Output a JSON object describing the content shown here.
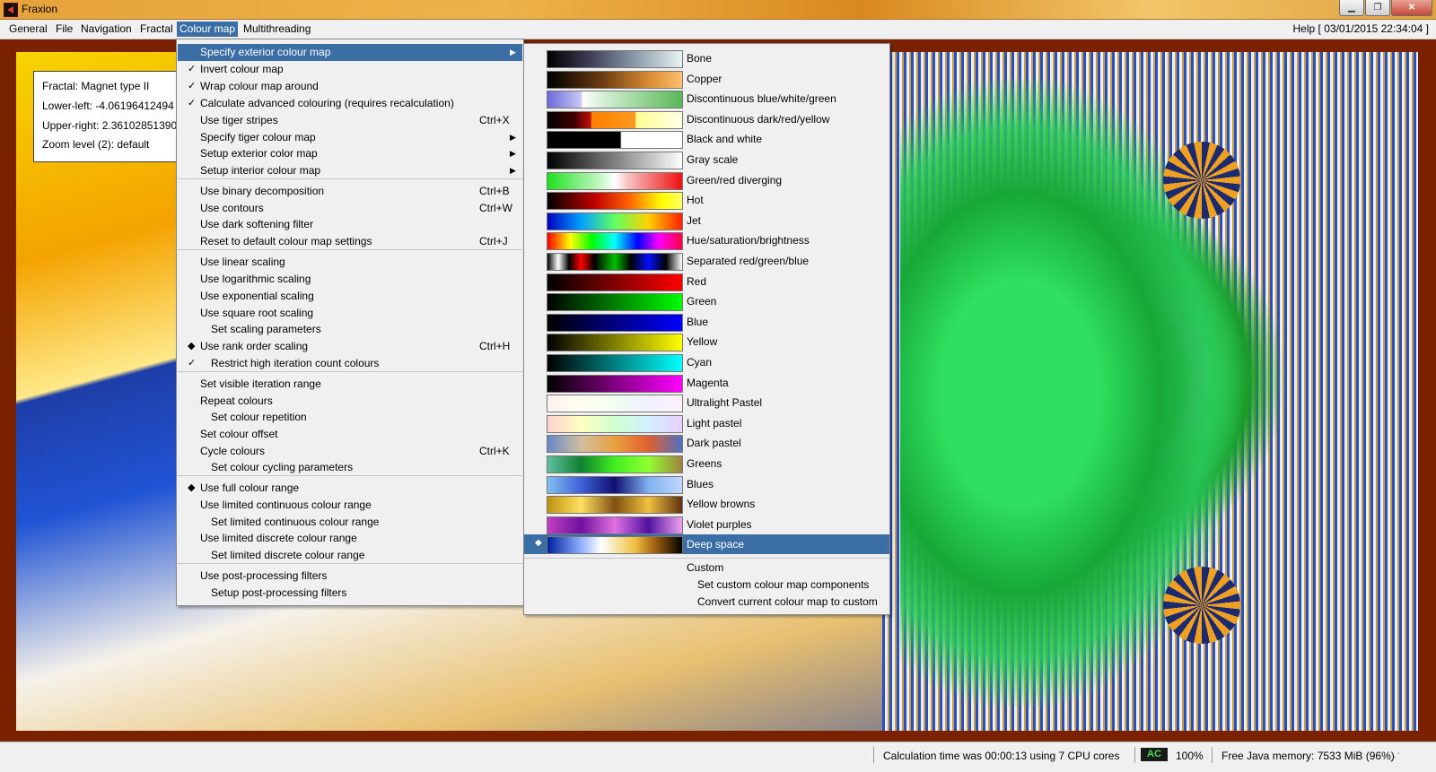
{
  "window": {
    "title": "Fraxion"
  },
  "menubar": {
    "items": [
      "General",
      "File",
      "Navigation",
      "Fractal",
      "Colour map",
      "Multithreading"
    ],
    "help": "Help",
    "datetime": "[ 03/01/2015 22:34:04 ]"
  },
  "info": {
    "fractal": "Fractal: Magnet type II",
    "lower_left": "Lower-left: -4.06196412494",
    "upper_right": "Upper-right: 2.36102851390",
    "zoom": "Zoom level (2): default"
  },
  "colour_menu": {
    "items": [
      {
        "label": "Specify exterior colour map",
        "mark": "",
        "shortcut": "",
        "submenu": true,
        "selected": true
      },
      {
        "label": "Invert colour map",
        "mark": "✓",
        "shortcut": "",
        "submenu": false
      },
      {
        "label": "Wrap colour map around",
        "mark": "✓",
        "shortcut": "",
        "submenu": false
      },
      {
        "label": "Calculate advanced colouring (requires recalculation)",
        "mark": "✓",
        "shortcut": "",
        "submenu": false
      },
      {
        "label": "Use tiger stripes",
        "mark": "",
        "shortcut": "Ctrl+X",
        "submenu": false
      },
      {
        "label": "Specify tiger colour map",
        "mark": "",
        "shortcut": "",
        "submenu": true
      },
      {
        "label": "Setup exterior color map",
        "mark": "",
        "shortcut": "",
        "submenu": true
      },
      {
        "label": "Setup interior colour map",
        "mark": "",
        "shortcut": "",
        "submenu": true
      },
      {
        "label": "Use binary decomposition",
        "mark": "",
        "shortcut": "Ctrl+B",
        "submenu": false
      },
      {
        "label": "Use contours",
        "mark": "",
        "shortcut": "Ctrl+W",
        "submenu": false
      },
      {
        "label": "Use dark softening filter",
        "mark": "",
        "shortcut": "",
        "submenu": false
      },
      {
        "label": "Reset to default colour map settings",
        "mark": "",
        "shortcut": "Ctrl+J",
        "submenu": false
      },
      {
        "label": "Use linear scaling",
        "mark": "",
        "shortcut": "",
        "submenu": false
      },
      {
        "label": "Use logarithmic scaling",
        "mark": "",
        "shortcut": "",
        "submenu": false
      },
      {
        "label": "Use exponential scaling",
        "mark": "",
        "shortcut": "",
        "submenu": false
      },
      {
        "label": "Use square root scaling",
        "mark": "",
        "shortcut": "",
        "submenu": false
      },
      {
        "label": "Set scaling parameters",
        "mark": "",
        "shortcut": "",
        "submenu": false,
        "indent": true
      },
      {
        "label": "Use rank order scaling",
        "mark": "◆",
        "shortcut": "Ctrl+H",
        "submenu": false
      },
      {
        "label": "Restrict high iteration count colours",
        "mark": "✓",
        "shortcut": "",
        "submenu": false,
        "indent": true
      },
      {
        "label": "Set visible iteration range",
        "mark": "",
        "shortcut": "",
        "submenu": false
      },
      {
        "label": "Repeat colours",
        "mark": "",
        "shortcut": "",
        "submenu": false
      },
      {
        "label": "Set colour repetition",
        "mark": "",
        "shortcut": "",
        "submenu": false,
        "indent": true
      },
      {
        "label": "Set colour offset",
        "mark": "",
        "shortcut": "",
        "submenu": false
      },
      {
        "label": "Cycle colours",
        "mark": "",
        "shortcut": "Ctrl+K",
        "submenu": false
      },
      {
        "label": "Set colour cycling parameters",
        "mark": "",
        "shortcut": "",
        "submenu": false,
        "indent": true
      },
      {
        "label": "Use full colour range",
        "mark": "◆",
        "shortcut": "",
        "submenu": false
      },
      {
        "label": "Use limited continuous colour range",
        "mark": "",
        "shortcut": "",
        "submenu": false
      },
      {
        "label": "Set limited continuous colour range",
        "mark": "",
        "shortcut": "",
        "submenu": false,
        "indent": true
      },
      {
        "label": "Use limited discrete colour range",
        "mark": "",
        "shortcut": "",
        "submenu": false
      },
      {
        "label": "Set limited discrete colour range",
        "mark": "",
        "shortcut": "",
        "submenu": false,
        "indent": true
      },
      {
        "label": "Use post-processing filters",
        "mark": "",
        "shortcut": "",
        "submenu": false
      },
      {
        "label": "Setup post-processing filters",
        "mark": "",
        "shortcut": "",
        "submenu": false,
        "indent": true
      }
    ]
  },
  "colour_maps": {
    "items": [
      {
        "name": "Bone",
        "gradient": "linear-gradient(90deg,#000 0%,#3a3a52 30%,#8a9aa8 65%,#e8f4f4 100%)"
      },
      {
        "name": "Copper",
        "gradient": "linear-gradient(90deg,#000 0%,#6a3a12 40%,#d88a30 75%,#ffc070 100%)"
      },
      {
        "name": "Discontinuous blue/white/green",
        "gradient": "linear-gradient(90deg,#6a6ad8 0%,#c8c8f8 25%,#fff 26%,#d8f0d8 40%,#58b858 100%)"
      },
      {
        "name": "Discontinuous dark/red/yellow",
        "gradient": "linear-gradient(90deg,#000 0%,#400000 20%,#c01000 32%,#ff8000 33%,#ff9820 65%,#ffff90 66%,#ffffe8 100%)"
      },
      {
        "name": "Black and white",
        "gradient": "linear-gradient(90deg,#000 0%,#000 54%,#fff 55%,#fff 100%)"
      },
      {
        "name": "Gray scale",
        "gradient": "linear-gradient(90deg,#000 0%,#fff 100%)"
      },
      {
        "name": "Green/red diverging",
        "gradient": "linear-gradient(90deg,#20e020 0%,#c8f8c8 40%,#fff 50%,#f8c0c0 60%,#f01010 100%)"
      },
      {
        "name": "Hot",
        "gradient": "linear-gradient(90deg,#000 0%,#c00000 35%,#ff6000 60%,#ffff00 85%,#ffff60 100%)"
      },
      {
        "name": "Jet",
        "gradient": "linear-gradient(90deg,#0000c0 0%,#00a0ff 25%,#60ff60 50%,#ffd000 75%,#ff2000 100%)"
      },
      {
        "name": "Hue/saturation/brightness",
        "gradient": "linear-gradient(90deg,#ff0000 0%,#ffff00 17%,#00ff00 33%,#00ffff 50%,#0000ff 67%,#ff00ff 83%,#ff0040 100%)"
      },
      {
        "name": "Separated red/green/blue",
        "gradient": "linear-gradient(90deg,#000 0%,#fff 8%,#000 16%,#ff0000 25%,#000 35%,#00c000 50%,#000 62%,#0010ff 75%,#000 88%,#fff 100%)"
      },
      {
        "name": "Red",
        "gradient": "linear-gradient(90deg,#000 0%,#ff0000 100%)"
      },
      {
        "name": "Green",
        "gradient": "linear-gradient(90deg,#000 0%,#00ff00 100%)"
      },
      {
        "name": "Blue",
        "gradient": "linear-gradient(90deg,#000 0%,#0000ff 100%)"
      },
      {
        "name": "Yellow",
        "gradient": "linear-gradient(90deg,#000 0%,#ffff00 100%)"
      },
      {
        "name": "Cyan",
        "gradient": "linear-gradient(90deg,#000 0%,#00ffff 100%)"
      },
      {
        "name": "Magenta",
        "gradient": "linear-gradient(90deg,#000 0%,#ff00ff 100%)"
      },
      {
        "name": "Ultralight Pastel",
        "gradient": "linear-gradient(90deg,#fff0f0,#fffff0,#f0fff0,#f0f0ff,#fff0ff)"
      },
      {
        "name": "Light pastel",
        "gradient": "linear-gradient(90deg,#ffd0d0,#ffffc0,#d0ffd0,#d0f0ff,#e8d0ff)"
      },
      {
        "name": "Dark pastel",
        "gradient": "linear-gradient(90deg,#6888c8,#d0c0a0,#e8a040,#e06030,#5070c0)"
      },
      {
        "name": "Greens",
        "gradient": "linear-gradient(90deg,#60c0a0,#108030,#40f020,#90ff30,#a08040)"
      },
      {
        "name": "Blues",
        "gradient": "linear-gradient(90deg,#80c0f0,#4060d8,#101070,#80b0f0,#c0d8ff)"
      },
      {
        "name": "Yellow browns",
        "gradient": "linear-gradient(90deg,#c09010,#ffe060,#805010,#f0c040,#603010)"
      },
      {
        "name": "Violet purples",
        "gradient": "linear-gradient(90deg,#c040c0,#7010a0,#e070e0,#5010a0,#f0a0f0)"
      },
      {
        "name": "Deep space",
        "gradient": "linear-gradient(90deg,#0020a0 0%,#90b0ff 25%,#ffffff 40%,#f0c040 65%,#a06010 80%,#000 100%)",
        "selected": true
      }
    ],
    "custom": "Custom",
    "set_custom": "Set custom colour map components",
    "convert_custom": "Convert current colour map to custom"
  },
  "status": {
    "calc_time": "Calculation time was 00:00:13 using 7 CPU cores",
    "ac": "AC",
    "zoom_pct": "100%",
    "memory": "Free Java memory: 7533 MiB (96%)"
  }
}
